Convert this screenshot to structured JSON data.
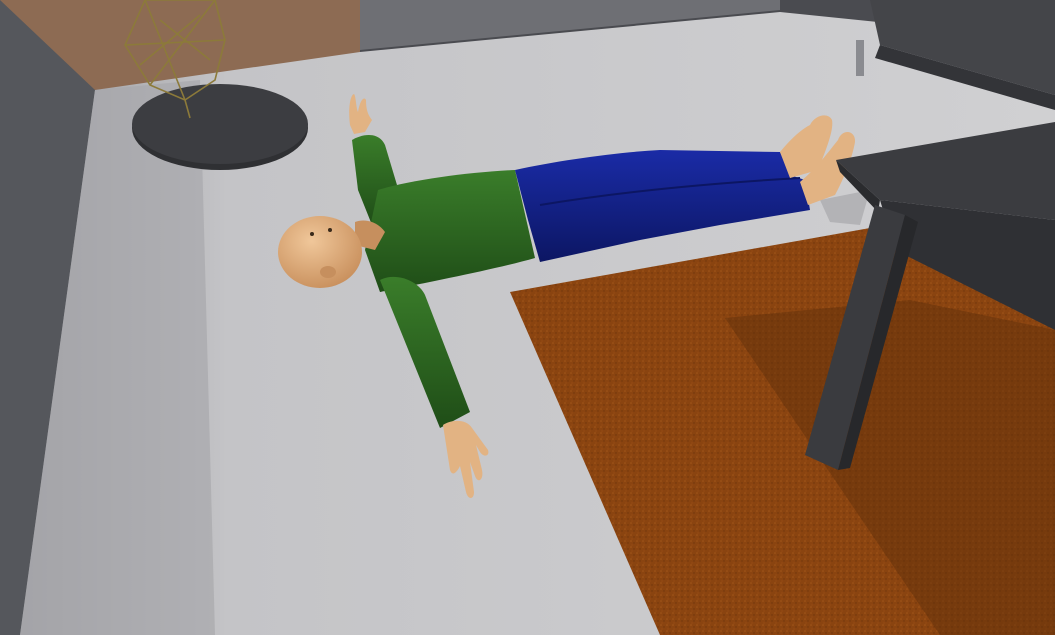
{
  "scene": {
    "kind": "3d-render",
    "subject": "human-figure-lying-on-floor",
    "objects": [
      "floor",
      "rug",
      "table",
      "round-side-table",
      "wire-lamp",
      "sofa",
      "wall",
      "human-figure"
    ]
  },
  "colors": {
    "floor": "#c9c9cc",
    "floor_shadow": "#b4b4b8",
    "wall_left": "#5b5d62",
    "wall_back": "#8d6b53",
    "rug": "#8a4410",
    "rug_dark": "#5e2e0a",
    "table": "#3b3c40",
    "table_dark": "#2a2b2e",
    "side_table": "#3a3b3e",
    "lamp_wire": "#8c7a3a",
    "skin": "#e2b383",
    "skin_shade": "#c68f5e",
    "shirt": "#2f6b22",
    "shirt_shade": "#1f4d17",
    "pants": "#13228c",
    "pants_shade": "#0c1663",
    "sofa": "#444549"
  }
}
